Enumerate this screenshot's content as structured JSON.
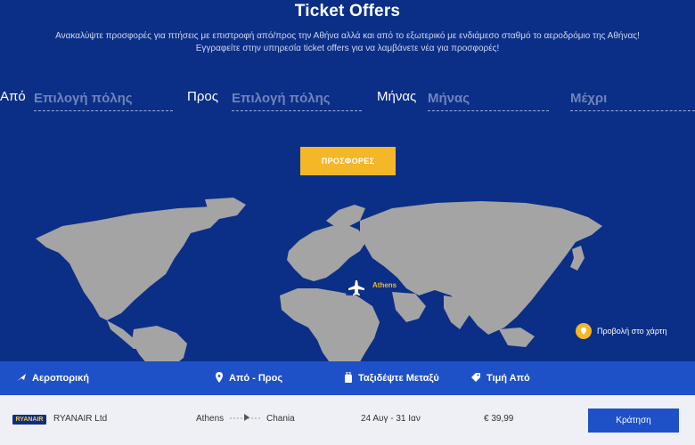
{
  "header": {
    "title": "Ticket Offers",
    "subtitle": "Ανακαλύψτε προσφορές για πτήσεις με επιστροφή από/προς την Αθήνα αλλά και από το εξωτερικό με ενδιάμεσο σταθμό το αεροδρόμιο της Αθήνας! Εγγραφείτε στην υπηρεσία ticket offers για να λαμβάνετε νέα για προσφορές!"
  },
  "search": {
    "from_label": "Από",
    "from_placeholder": "Επιλογή πόλης",
    "to_label": "Προς",
    "to_placeholder": "Επιλογή πόλης",
    "month_label": "Μήνας",
    "month_placeholder": "Μήνας",
    "until_placeholder": "Μέχρι",
    "button_label": "ΠΡΟΣΦΟΡΕΣ"
  },
  "map": {
    "marker_label": "Athens",
    "view_map_label": "Προβολή στο χάρτη"
  },
  "table": {
    "headers": [
      "Αεροπορική",
      "Από - Προς",
      "Ταξιδέψτε Μεταξύ",
      "Τιμή Από"
    ],
    "rows": [
      {
        "logo_text": "RYANAIR",
        "airline": "RYANAIR Ltd",
        "from": "Athens",
        "to": "Chania",
        "dates": "24 Αυγ - 31 Ιαν",
        "price": "€ 39,99",
        "action": "Κράτηση"
      }
    ]
  },
  "colors": {
    "background": "#0b2f86",
    "accent": "#f4b728",
    "header_bar": "#1e51c8",
    "land": "#a4a4a4"
  }
}
